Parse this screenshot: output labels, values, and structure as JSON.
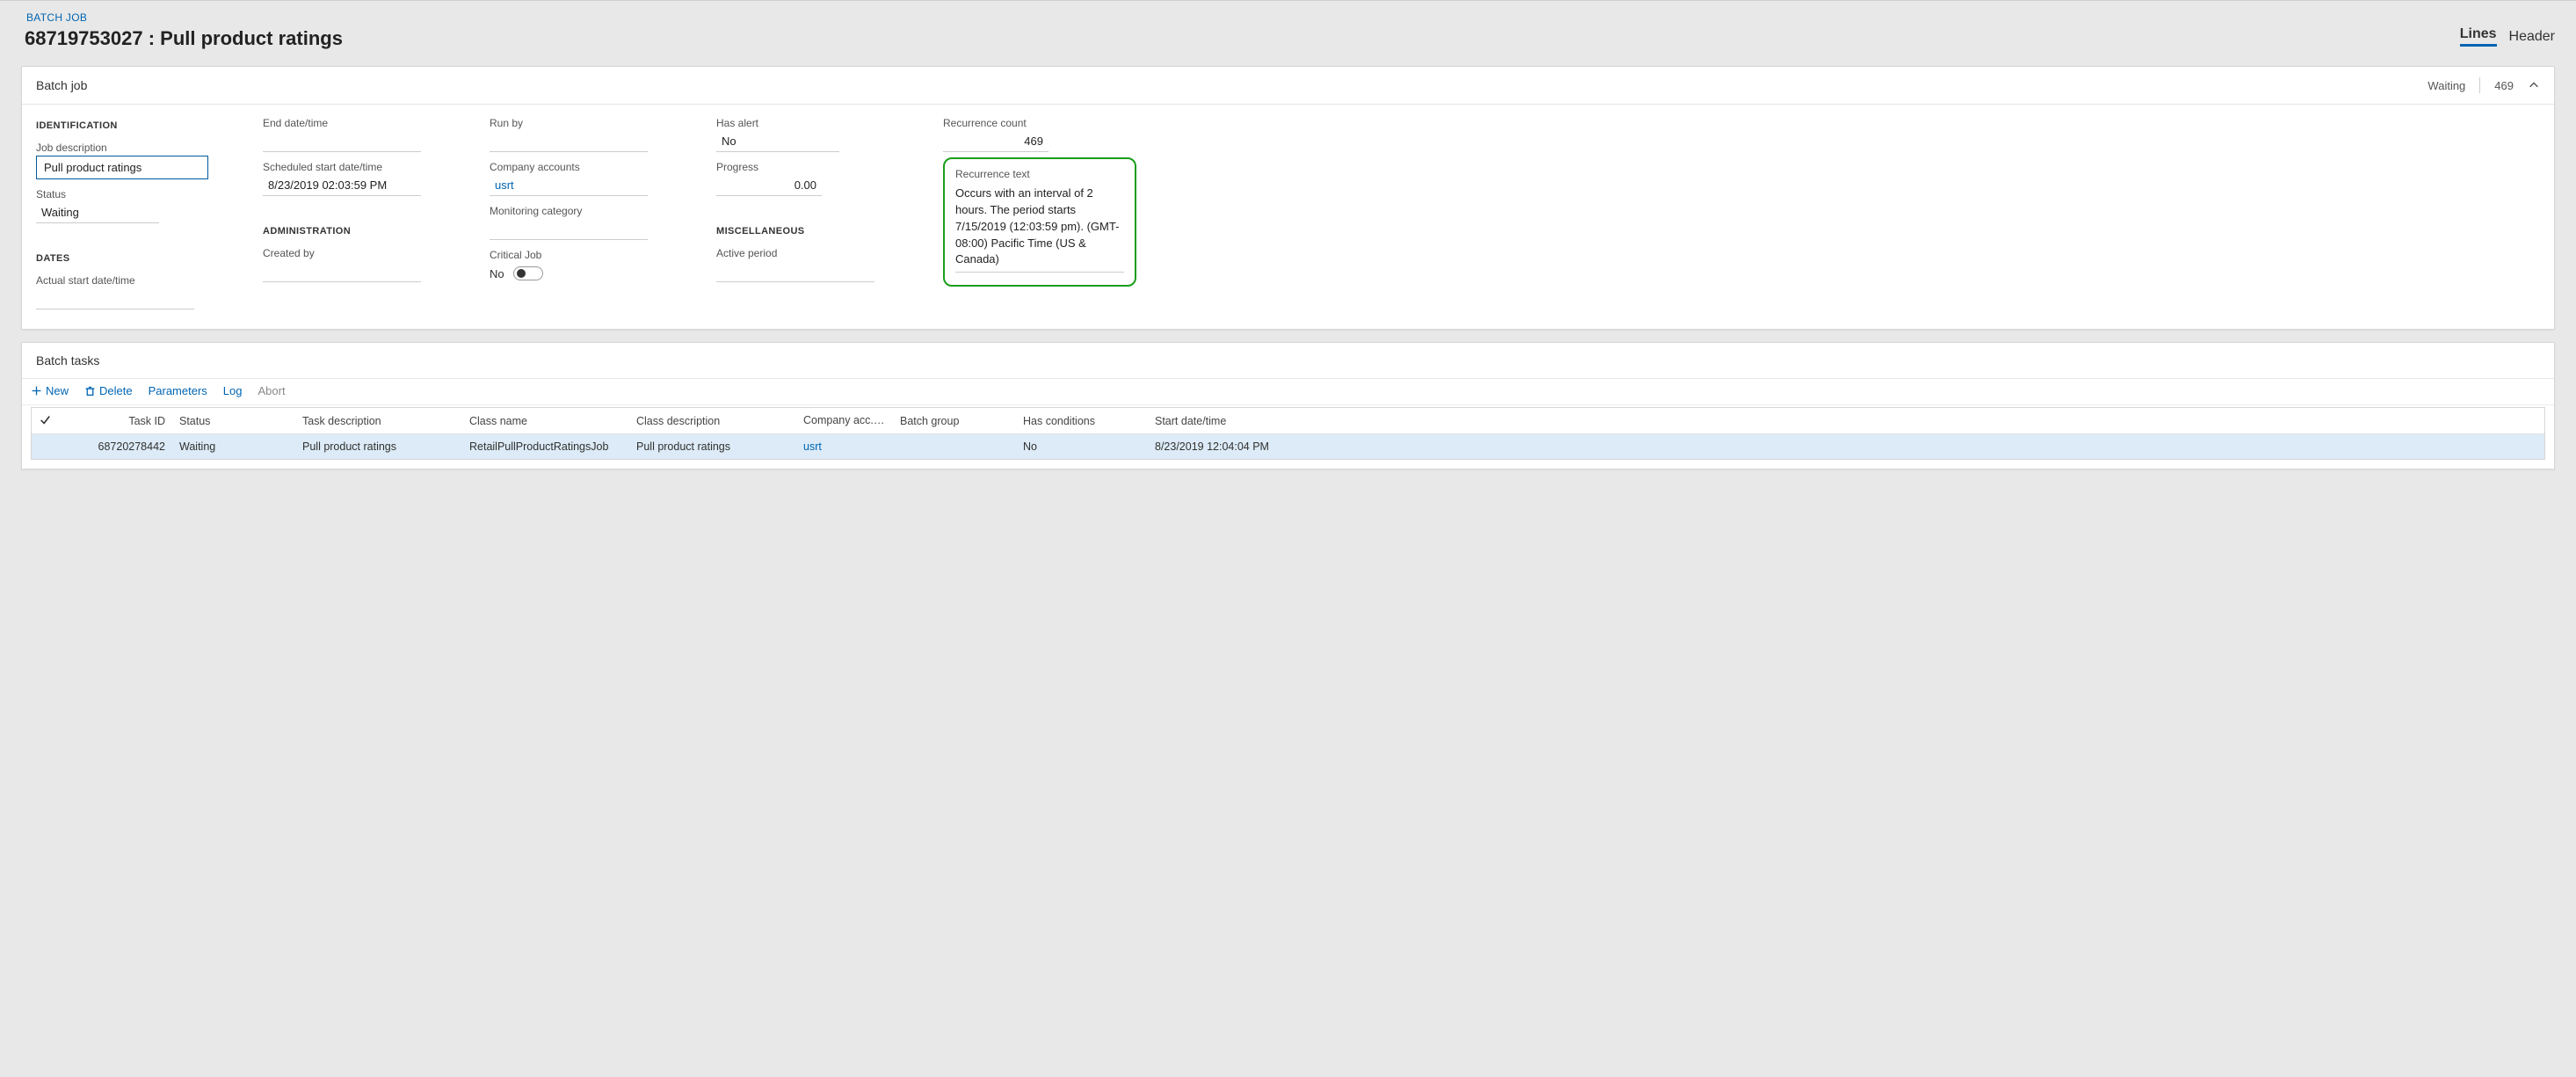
{
  "breadcrumb": "BATCH JOB",
  "page_title": "68719753027 : Pull product ratings",
  "tabs": {
    "lines": "Lines",
    "header": "Header",
    "active": "lines"
  },
  "batch_job": {
    "card_title": "Batch job",
    "status_chip": "Waiting",
    "count_chip": "469",
    "identification": {
      "section": "IDENTIFICATION",
      "job_description_label": "Job description",
      "job_description": "Pull product ratings",
      "status_label": "Status",
      "status": "Waiting"
    },
    "dates": {
      "section": "DATES",
      "actual_start_label": "Actual start date/time",
      "actual_start": "",
      "end_label": "End date/time",
      "end": "",
      "scheduled_start_label": "Scheduled start date/time",
      "scheduled_start": "8/23/2019 02:03:59 PM"
    },
    "administration": {
      "section": "ADMINISTRATION",
      "created_by_label": "Created by",
      "created_by": ""
    },
    "run": {
      "run_by_label": "Run by",
      "run_by": "",
      "company_accounts_label": "Company accounts",
      "company_accounts": "usrt",
      "monitoring_category_label": "Monitoring category",
      "monitoring_category": "",
      "critical_job_label": "Critical Job",
      "critical_job_value": "No"
    },
    "alerts": {
      "has_alert_label": "Has alert",
      "has_alert": "No",
      "progress_label": "Progress",
      "progress": "0.00"
    },
    "misc": {
      "section": "MISCELLANEOUS",
      "active_period_label": "Active period",
      "active_period": ""
    },
    "recurrence": {
      "count_label": "Recurrence count",
      "count": "469",
      "text_label": "Recurrence text",
      "text": "Occurs with an interval of 2 hours. The period starts 7/15/2019 (12:03:59 pm). (GMT-08:00) Pacific Time (US & Canada)"
    }
  },
  "batch_tasks": {
    "card_title": "Batch tasks",
    "toolbar": {
      "new": "New",
      "delete": "Delete",
      "parameters": "Parameters",
      "log": "Log",
      "abort": "Abort"
    },
    "columns": {
      "task_id": "Task ID",
      "status": "Status",
      "task_description": "Task description",
      "class_name": "Class name",
      "class_description": "Class description",
      "company_accounts": "Company acc...",
      "batch_group": "Batch group",
      "has_conditions": "Has conditions",
      "start_datetime": "Start date/time"
    },
    "rows": [
      {
        "task_id": "68720278442",
        "status": "Waiting",
        "task_description": "Pull product ratings",
        "class_name": "RetailPullProductRatingsJob",
        "class_description": "Pull product ratings",
        "company_accounts": "usrt",
        "batch_group": "",
        "has_conditions": "No",
        "start_datetime": "8/23/2019 12:04:04 PM"
      }
    ]
  }
}
